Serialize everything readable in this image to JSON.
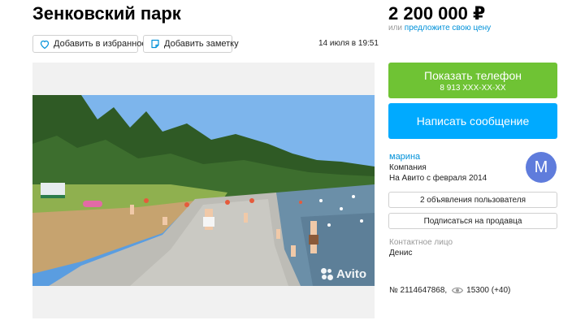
{
  "listing": {
    "title": "Зенковский парк",
    "price": "2 200 000 ₽",
    "price_prefix": "или",
    "price_offer_link": "предложите свою цену",
    "date": "14 июля в 19:51",
    "favorite_label": "Добавить в избранное",
    "note_label": "Добавить заметку",
    "image_watermark": "Avito",
    "item_number": "№ 2114647868,",
    "views": "15300 (+40)"
  },
  "actions": {
    "show_phone_label": "Показать телефон",
    "phone_masked": "8 913 XXX-XX-XX",
    "message_label": "Написать сообщение"
  },
  "seller": {
    "name": "марина",
    "type": "Компания",
    "since": "На Авито с февраля 2014",
    "avatar_letter": "М",
    "listings_button": "2 объявления пользователя",
    "subscribe_button": "Подписаться на продавца",
    "contact_label": "Контактное лицо",
    "contact_name": "Денис"
  },
  "icons": [
    "heart-icon",
    "note-icon",
    "eye-icon",
    "avito-logo-icon"
  ],
  "colors": {
    "green_button": "#6fc334",
    "blue_button": "#00aaff",
    "link": "#0091d9",
    "avatar": "#5f7cdc"
  }
}
